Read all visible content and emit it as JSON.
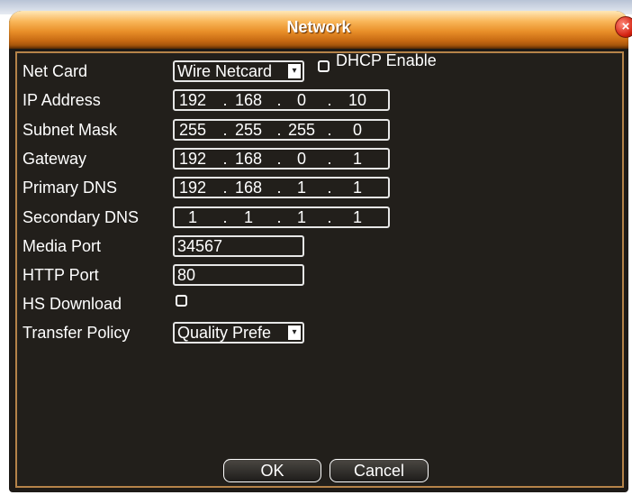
{
  "window": {
    "title": "Network",
    "close_glyph": "×"
  },
  "form": {
    "net_card": {
      "label": "Net Card",
      "value": "Wire Netcard"
    },
    "dhcp": {
      "label": "DHCP Enable",
      "checked": false
    },
    "ip_address": {
      "label": "IP Address",
      "octets": [
        "192",
        "168",
        "0",
        "10"
      ]
    },
    "subnet_mask": {
      "label": "Subnet Mask",
      "octets": [
        "255",
        "255",
        "255",
        "0"
      ]
    },
    "gateway": {
      "label": "Gateway",
      "octets": [
        "192",
        "168",
        "0",
        "1"
      ]
    },
    "primary_dns": {
      "label": "Primary DNS",
      "octets": [
        "192",
        "168",
        "1",
        "1"
      ]
    },
    "secondary_dns": {
      "label": "Secondary DNS",
      "octets": [
        "1",
        "1",
        "1",
        "1"
      ]
    },
    "media_port": {
      "label": "Media Port",
      "value": "34567"
    },
    "http_port": {
      "label": "HTTP Port",
      "value": "80"
    },
    "hs_download": {
      "label": "HS Download",
      "checked": false
    },
    "transfer_policy": {
      "label": "Transfer Policy",
      "value": "Quality Prefe"
    },
    "ip_separator": "."
  },
  "buttons": {
    "ok": "OK",
    "cancel": "Cancel"
  },
  "icons": {
    "dropdown_arrow": "chevron-down-icon",
    "close": "close-icon"
  },
  "colors": {
    "title_orange": "#e88e28",
    "panel_border": "#b58349",
    "background": "#221f1b",
    "text": "#ffffff",
    "close_red": "#d21f0e"
  }
}
